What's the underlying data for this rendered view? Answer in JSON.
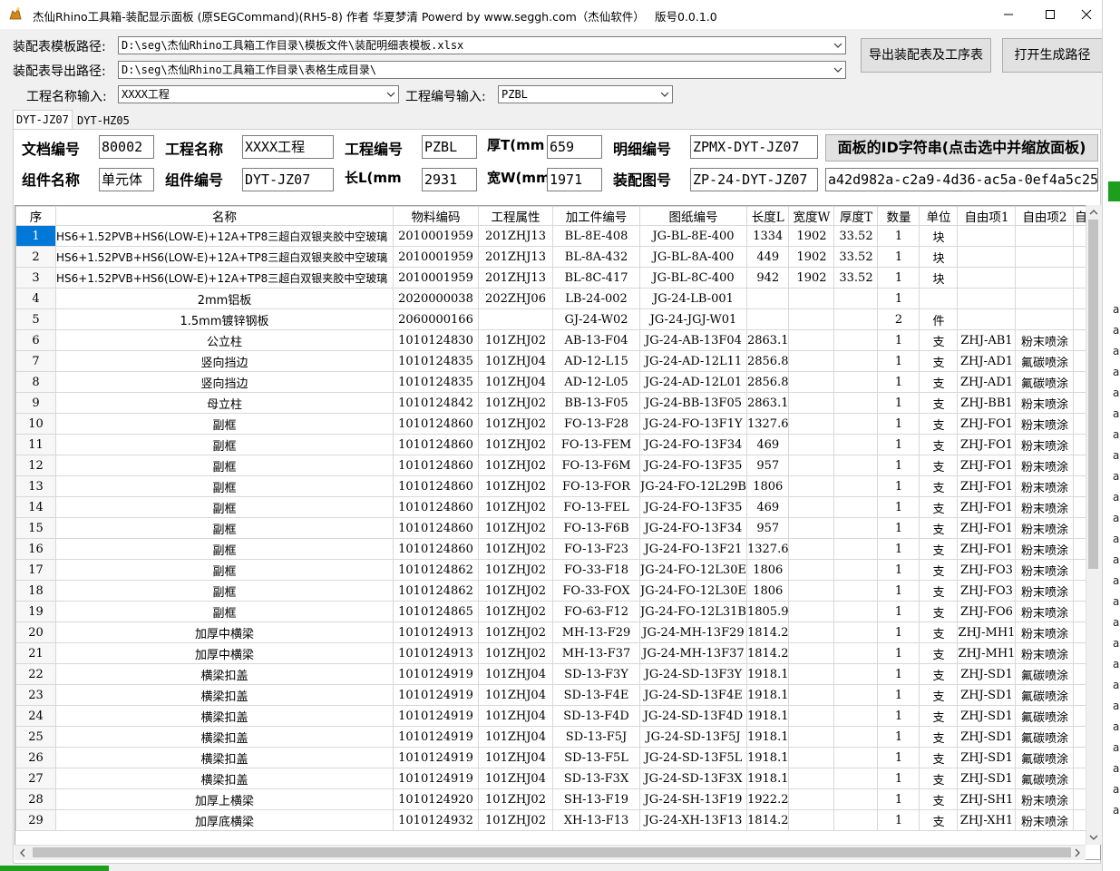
{
  "window": {
    "title": "杰仙Rhino工具箱-装配显示面板    (原SEGCommand)(RH5-8) 作者 华夏梦清 Powerd by  www.seggh.com（杰仙软件）",
    "version": "版号0.0.1.0"
  },
  "paths": {
    "template_label": "装配表模板路径:",
    "template_value": "D:\\seg\\杰仙Rhino工具箱工作目录\\模板文件\\装配明细表模板.xlsx",
    "export_label": "装配表导出路径:",
    "export_value": "D:\\seg\\杰仙Rhino工具箱工作目录\\表格生成目录\\",
    "project_name_label": "工程名称输入:",
    "project_name_value": "XXXX工程",
    "project_code_label": "工程编号输入:",
    "project_code_value": "PZBL",
    "export_button": "导出装配表及工序表",
    "open_button": "打开生成路径"
  },
  "tabs": [
    "DYT-JZ07",
    "DYT-HZ05"
  ],
  "info": {
    "doc_no_label": "文档编号",
    "doc_no": "80002",
    "proj_name_label": "工程名称",
    "proj_name": "XXXX工程",
    "proj_code_label": "工程编号",
    "proj_code": "PZBL",
    "thick_label": "厚T(mm",
    "thick": "659",
    "detail_no_label": "明细编号",
    "detail_no": "ZPMX-DYT-JZ07",
    "panel_id_button": "面板的ID字符串(点击选中并缩放面板)",
    "comp_name_label": "组件名称",
    "comp_name": "单元体",
    "comp_code_label": "组件编号",
    "comp_code": "DYT-JZ07",
    "len_label": "长L(mm",
    "len": "2931",
    "width_label": "宽W(mm",
    "width": "1971",
    "asm_no_label": "装配图号",
    "asm_no": "ZP-24-DYT-JZ07",
    "panel_id": "a42d982a-c2a9-4d36-ac5a-0ef4a5c25"
  },
  "table": {
    "headers": [
      "序",
      "名称",
      "物料编码",
      "工程属性",
      "加工件编号",
      "图纸编号",
      "长度L",
      "宽度W",
      "厚度T",
      "数量",
      "单位",
      "自由项1",
      "自由项2",
      "自"
    ],
    "rows": [
      [
        "1",
        "HS6+1.52PVB+HS6(LOW-E)+12A+TP8三超白双银夹胶中空玻璃",
        "2010001959",
        "201ZHJ13",
        "BL-8E-408",
        "JG-BL-8E-400",
        "1334",
        "1902",
        "33.52",
        "1",
        "块",
        "",
        ""
      ],
      [
        "2",
        "HS6+1.52PVB+HS6(LOW-E)+12A+TP8三超白双银夹胶中空玻璃",
        "2010001959",
        "201ZHJ13",
        "BL-8A-432",
        "JG-BL-8A-400",
        "449",
        "1902",
        "33.52",
        "1",
        "块",
        "",
        ""
      ],
      [
        "3",
        "HS6+1.52PVB+HS6(LOW-E)+12A+TP8三超白双银夹胶中空玻璃",
        "2010001959",
        "201ZHJ13",
        "BL-8C-417",
        "JG-BL-8C-400",
        "942",
        "1902",
        "33.52",
        "1",
        "块",
        "",
        ""
      ],
      [
        "4",
        "2mm铝板",
        "2020000038",
        "202ZHJ06",
        "LB-24-002",
        "JG-24-LB-001",
        "",
        "",
        "",
        "1",
        "",
        "",
        ""
      ],
      [
        "5",
        "1.5mm镀锌钢板",
        "2060000166",
        "",
        "GJ-24-W02",
        "JG-24-JGJ-W01",
        "",
        "",
        "",
        "2",
        "件",
        "",
        ""
      ],
      [
        "6",
        "公立柱",
        "1010124830",
        "101ZHJ02",
        "AB-13-F04",
        "JG-24-AB-13F04",
        "2863.1",
        "",
        "",
        "1",
        "支",
        "ZHJ-AB1",
        "粉末喷涂"
      ],
      [
        "7",
        "竖向挡边",
        "1010124835",
        "101ZHJ04",
        "AD-12-L15",
        "JG-24-AD-12L11",
        "2856.8",
        "",
        "",
        "1",
        "支",
        "ZHJ-AD1",
        "氟碳喷涂"
      ],
      [
        "8",
        "竖向挡边",
        "1010124835",
        "101ZHJ04",
        "AD-12-L05",
        "JG-24-AD-12L01",
        "2856.8",
        "",
        "",
        "1",
        "支",
        "ZHJ-AD1",
        "氟碳喷涂"
      ],
      [
        "9",
        "母立柱",
        "1010124842",
        "101ZHJ02",
        "BB-13-F05",
        "JG-24-BB-13F05",
        "2863.1",
        "",
        "",
        "1",
        "支",
        "ZHJ-BB1",
        "粉末喷涂"
      ],
      [
        "10",
        "副框",
        "1010124860",
        "101ZHJ02",
        "FO-13-F28",
        "JG-24-FO-13F1Y",
        "1327.6",
        "",
        "",
        "1",
        "支",
        "ZHJ-FO1",
        "粉末喷涂"
      ],
      [
        "11",
        "副框",
        "1010124860",
        "101ZHJ02",
        "FO-13-FEM",
        "JG-24-FO-13F34",
        "469",
        "",
        "",
        "1",
        "支",
        "ZHJ-FO1",
        "粉末喷涂"
      ],
      [
        "12",
        "副框",
        "1010124860",
        "101ZHJ02",
        "FO-13-F6M",
        "JG-24-FO-13F35",
        "957",
        "",
        "",
        "1",
        "支",
        "ZHJ-FO1",
        "粉末喷涂"
      ],
      [
        "13",
        "副框",
        "1010124860",
        "101ZHJ02",
        "FO-13-FOR",
        "JG-24-FO-12L29B",
        "1806",
        "",
        "",
        "1",
        "支",
        "ZHJ-FO1",
        "粉末喷涂"
      ],
      [
        "14",
        "副框",
        "1010124860",
        "101ZHJ02",
        "FO-13-FEL",
        "JG-24-FO-13F35",
        "469",
        "",
        "",
        "1",
        "支",
        "ZHJ-FO1",
        "粉末喷涂"
      ],
      [
        "15",
        "副框",
        "1010124860",
        "101ZHJ02",
        "FO-13-F6B",
        "JG-24-FO-13F34",
        "957",
        "",
        "",
        "1",
        "支",
        "ZHJ-FO1",
        "粉末喷涂"
      ],
      [
        "16",
        "副框",
        "1010124860",
        "101ZHJ02",
        "FO-13-F23",
        "JG-24-FO-13F21",
        "1327.6",
        "",
        "",
        "1",
        "支",
        "ZHJ-FO1",
        "粉末喷涂"
      ],
      [
        "17",
        "副框",
        "1010124862",
        "101ZHJ02",
        "FO-33-F18",
        "JG-24-FO-12L30E",
        "1806",
        "",
        "",
        "1",
        "支",
        "ZHJ-FO3",
        "粉末喷涂"
      ],
      [
        "18",
        "副框",
        "1010124862",
        "101ZHJ02",
        "FO-33-FOX",
        "JG-24-FO-12L30E",
        "1806",
        "",
        "",
        "1",
        "支",
        "ZHJ-FO3",
        "粉末喷涂"
      ],
      [
        "19",
        "副框",
        "1010124865",
        "101ZHJ02",
        "FO-63-F12",
        "JG-24-FO-12L31B",
        "1805.9",
        "",
        "",
        "1",
        "支",
        "ZHJ-FO6",
        "粉末喷涂"
      ],
      [
        "20",
        "加厚中横梁",
        "1010124913",
        "101ZHJ02",
        "MH-13-F29",
        "JG-24-MH-13F29",
        "1814.2",
        "",
        "",
        "1",
        "支",
        "ZHJ-MH1",
        "粉末喷涂"
      ],
      [
        "21",
        "加厚中横梁",
        "1010124913",
        "101ZHJ02",
        "MH-13-F37",
        "JG-24-MH-13F37",
        "1814.2",
        "",
        "",
        "1",
        "支",
        "ZHJ-MH1",
        "粉末喷涂"
      ],
      [
        "22",
        "横梁扣盖",
        "1010124919",
        "101ZHJ04",
        "SD-13-F3Y",
        "JG-24-SD-13F3Y",
        "1918.1",
        "",
        "",
        "1",
        "支",
        "ZHJ-SD1",
        "氟碳喷涂"
      ],
      [
        "23",
        "横梁扣盖",
        "1010124919",
        "101ZHJ04",
        "SD-13-F4E",
        "JG-24-SD-13F4E",
        "1918.1",
        "",
        "",
        "1",
        "支",
        "ZHJ-SD1",
        "氟碳喷涂"
      ],
      [
        "24",
        "横梁扣盖",
        "1010124919",
        "101ZHJ04",
        "SD-13-F4D",
        "JG-24-SD-13F4D",
        "1918.1",
        "",
        "",
        "1",
        "支",
        "ZHJ-SD1",
        "氟碳喷涂"
      ],
      [
        "25",
        "横梁扣盖",
        "1010124919",
        "101ZHJ04",
        "SD-13-F5J",
        "JG-24-SD-13F5J",
        "1918.1",
        "",
        "",
        "1",
        "支",
        "ZHJ-SD1",
        "氟碳喷涂"
      ],
      [
        "26",
        "横梁扣盖",
        "1010124919",
        "101ZHJ04",
        "SD-13-F5L",
        "JG-24-SD-13F5L",
        "1918.1",
        "",
        "",
        "1",
        "支",
        "ZHJ-SD1",
        "氟碳喷涂"
      ],
      [
        "27",
        "横梁扣盖",
        "1010124919",
        "101ZHJ04",
        "SD-13-F3X",
        "JG-24-SD-13F3X",
        "1918.1",
        "",
        "",
        "1",
        "支",
        "ZHJ-SD1",
        "氟碳喷涂"
      ],
      [
        "28",
        "加厚上横梁",
        "1010124920",
        "101ZHJ02",
        "SH-13-F19",
        "JG-24-SH-13F19",
        "1922.2",
        "",
        "",
        "1",
        "支",
        "ZHJ-SH1",
        "粉末喷涂"
      ],
      [
        "29",
        "加厚底横梁",
        "1010124932",
        "101ZHJ02",
        "XH-13-F13",
        "JG-24-XH-13F13",
        "1814.2",
        "",
        "",
        "1",
        "支",
        "ZHJ-XH1",
        "粉末喷涂"
      ]
    ]
  },
  "right_strip_glyphs": [
    "a",
    "a",
    "a",
    "a",
    "a",
    "a",
    "a",
    "a",
    "a",
    "a",
    "a",
    "a",
    "a",
    "a",
    "a",
    "a",
    "a",
    "a",
    "a",
    "a",
    "a",
    "a",
    "a",
    "a",
    "a"
  ],
  "colors": {
    "selection": "#0078d7",
    "accent_green": "#1e9e1e"
  }
}
